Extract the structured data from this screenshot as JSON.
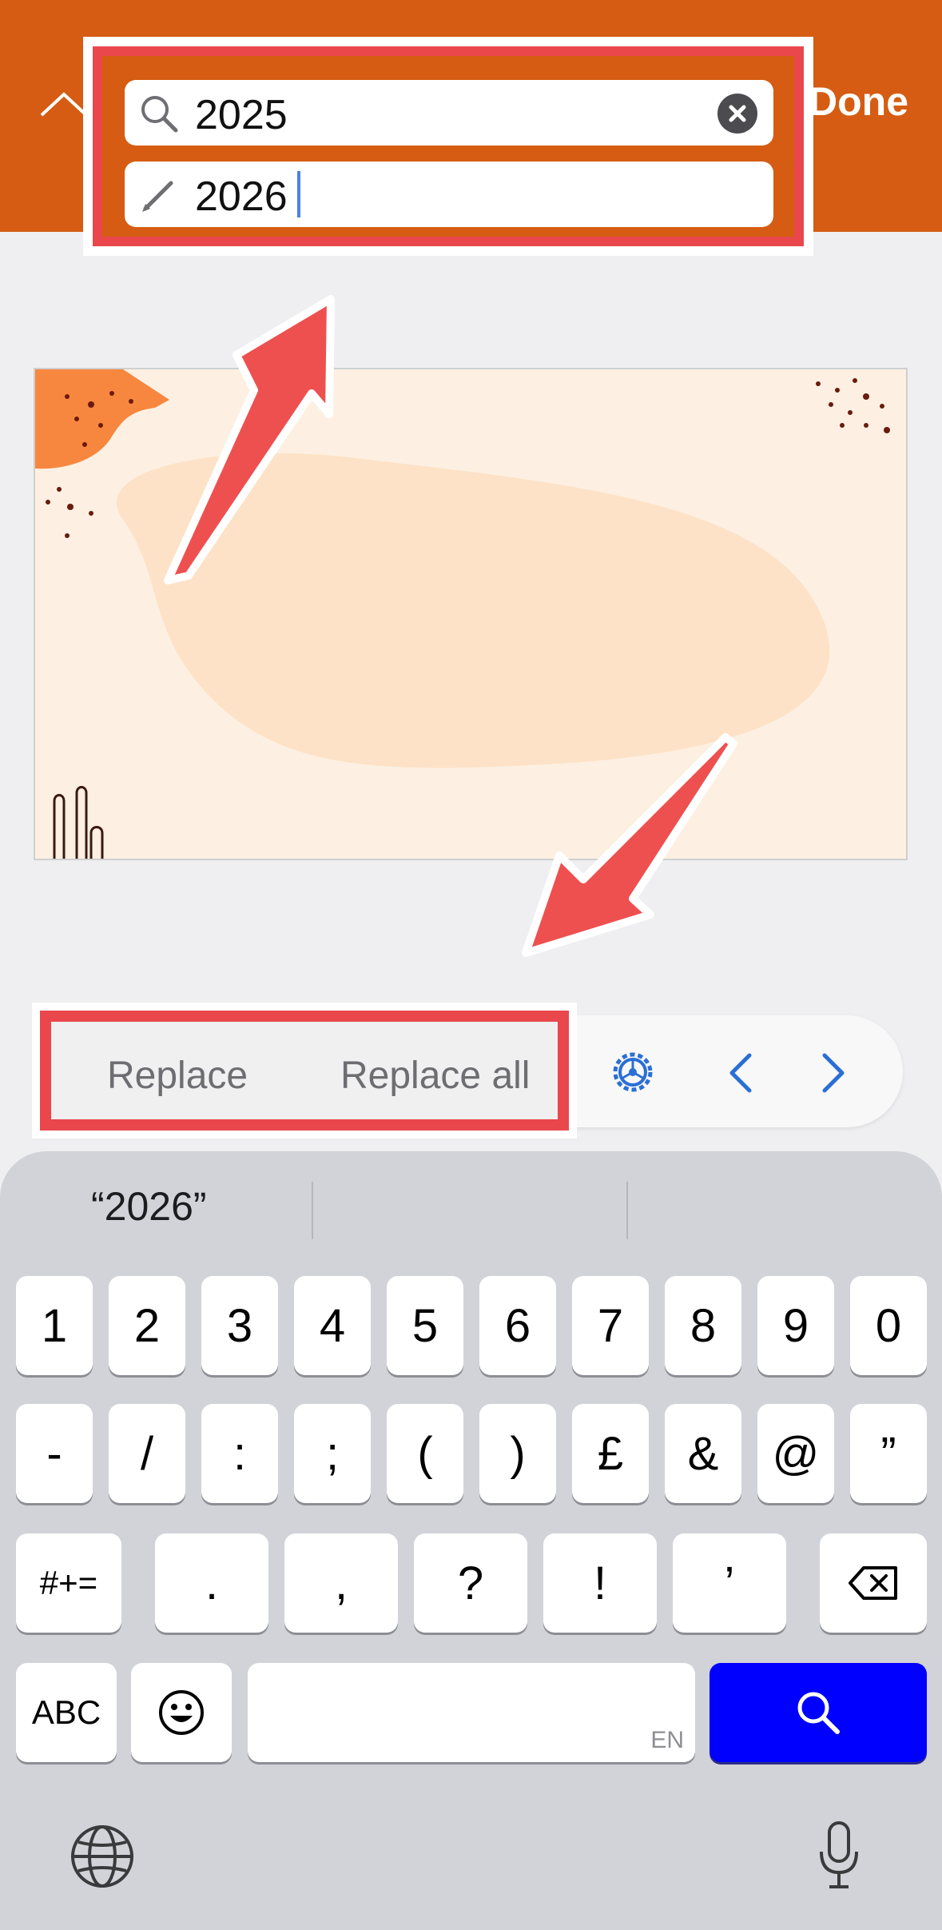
{
  "header": {
    "done_label": "Done",
    "find_value": "2025",
    "replace_value": "2026",
    "accent": "#d55c12"
  },
  "toolbar": {
    "replace_label": "Replace",
    "replace_all_label": "Replace all",
    "options_icon": "gear-icon",
    "prev_icon": "chevron-left-icon",
    "next_icon": "chevron-right-icon",
    "highlight_color": "#e9474c"
  },
  "keyboard": {
    "suggestion": "“2026”",
    "row1": [
      "1",
      "2",
      "3",
      "4",
      "5",
      "6",
      "7",
      "8",
      "9",
      "0"
    ],
    "row2": [
      "-",
      "/",
      ":",
      ";",
      "(",
      ")",
      "£",
      "&",
      "@",
      "”"
    ],
    "row3": [
      ".",
      ",",
      "?",
      "!",
      "’"
    ],
    "symbols_label": "#+=",
    "abc_label": "ABC",
    "space_lang": "EN",
    "search_color": "#0000ff"
  }
}
